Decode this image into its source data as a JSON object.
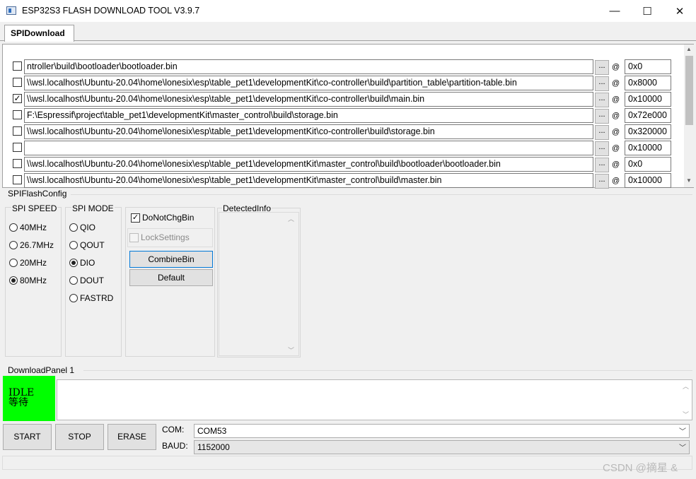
{
  "window": {
    "title": "ESP32S3 FLASH DOWNLOAD TOOL V3.9.7",
    "min_glyph": "—",
    "max_glyph": "☐",
    "close_glyph": "✕"
  },
  "tabs": {
    "active": "SPIDownload"
  },
  "files": [
    {
      "checked": false,
      "path": "ntroller\\build\\bootloader\\bootloader.bin",
      "address": "0x0"
    },
    {
      "checked": false,
      "path": "\\\\wsl.localhost\\Ubuntu-20.04\\home\\lonesix\\esp\\table_pet1\\developmentKit\\co-controller\\build\\partition_table\\partition-table.bin",
      "address": "0x8000"
    },
    {
      "checked": true,
      "path": "\\\\wsl.localhost\\Ubuntu-20.04\\home\\lonesix\\esp\\table_pet1\\developmentKit\\co-controller\\build\\main.bin",
      "address": "0x10000"
    },
    {
      "checked": false,
      "path": "F:\\Espressif\\project\\table_pet1\\developmentKit\\master_control\\build\\storage.bin",
      "address": "0x72e000"
    },
    {
      "checked": false,
      "path": "\\\\wsl.localhost\\Ubuntu-20.04\\home\\lonesix\\esp\\table_pet1\\developmentKit\\co-controller\\build\\storage.bin",
      "address": "0x320000"
    },
    {
      "checked": false,
      "path": "",
      "address": "0x10000"
    },
    {
      "checked": false,
      "path": "\\\\wsl.localhost\\Ubuntu-20.04\\home\\lonesix\\esp\\table_pet1\\developmentKit\\master_control\\build\\bootloader\\bootloader.bin",
      "address": "0x0"
    },
    {
      "checked": false,
      "path": "\\\\wsl.localhost\\Ubuntu-20.04\\home\\lonesix\\esp\\table_pet1\\developmentKit\\master_control\\build\\master.bin",
      "address": "0x10000"
    }
  ],
  "file_row": {
    "browse_label": "...",
    "at_label": "@"
  },
  "config": {
    "title": "SPIFlashConfig",
    "speed": {
      "title": "SPI SPEED",
      "options": [
        "40MHz",
        "26.7MHz",
        "20MHz",
        "80MHz"
      ],
      "selected": "80MHz"
    },
    "mode": {
      "title": "SPI MODE",
      "options": [
        "QIO",
        "QOUT",
        "DIO",
        "DOUT",
        "FASTRD"
      ],
      "selected": "DIO"
    },
    "do_not_chg_bin": {
      "label": "DoNotChgBin",
      "checked": true
    },
    "lock_settings": {
      "label": "LockSettings",
      "checked": false
    },
    "combine_bin_label": "CombineBin",
    "default_label": "Default",
    "detected_info_title": "DetectedInfo"
  },
  "download_panel": {
    "title": "DownloadPanel 1",
    "state_line1": "IDLE",
    "state_line2": "等待",
    "state_color": "#00ff00",
    "start_label": "START",
    "stop_label": "STOP",
    "erase_label": "ERASE",
    "com_label": "COM:",
    "com_value": "COM53",
    "baud_label": "BAUD:",
    "baud_value": "1152000"
  },
  "watermark": "CSDN @摘星 &"
}
